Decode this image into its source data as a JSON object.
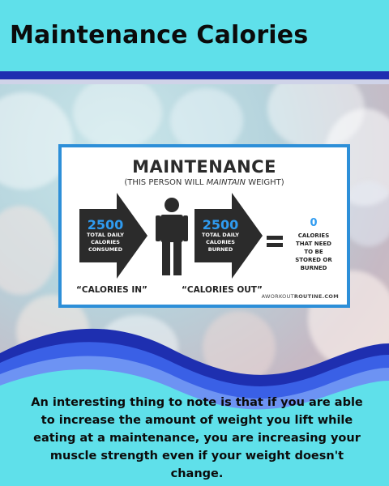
{
  "header": {
    "title": "Maintenance Calories"
  },
  "infographic": {
    "title": "MAINTENANCE",
    "subtitle_pre": "(THIS PERSON WILL ",
    "subtitle_em": "MAINTAIN",
    "subtitle_post": " WEIGHT)",
    "left_arrow": {
      "number": "2500",
      "line1": "TOTAL DAILY",
      "line2": "CALORIES",
      "line3": "CONSUMED"
    },
    "right_arrow": {
      "number": "2500",
      "line1": "TOTAL DAILY",
      "line2": "CALORIES",
      "line3": "BURNED"
    },
    "result": {
      "number": "0",
      "line1": "CALORIES",
      "line2": "THAT NEED",
      "line3": "TO BE",
      "line4": "STORED OR",
      "line5": "BURNED"
    },
    "caption_in": "“CALORIES IN”",
    "caption_out": "“CALORIES OUT”",
    "site_pre": "AWORKOUT",
    "site_post": "ROUTINE.COM"
  },
  "body": {
    "paragraph": "An interesting thing to note is that if you are able to increase the amount of weight you lift while eating at a maintenance, you are increasing your muscle strength even if your weight doesn't change."
  },
  "colors": {
    "background": "#5fe0ea",
    "navy": "#1e2fb0",
    "accent_blue": "#2f9bf0",
    "arrow_dark": "#2b2b2b"
  },
  "icons": [
    "person-icon",
    "equals-icon",
    "arrow-shape"
  ]
}
